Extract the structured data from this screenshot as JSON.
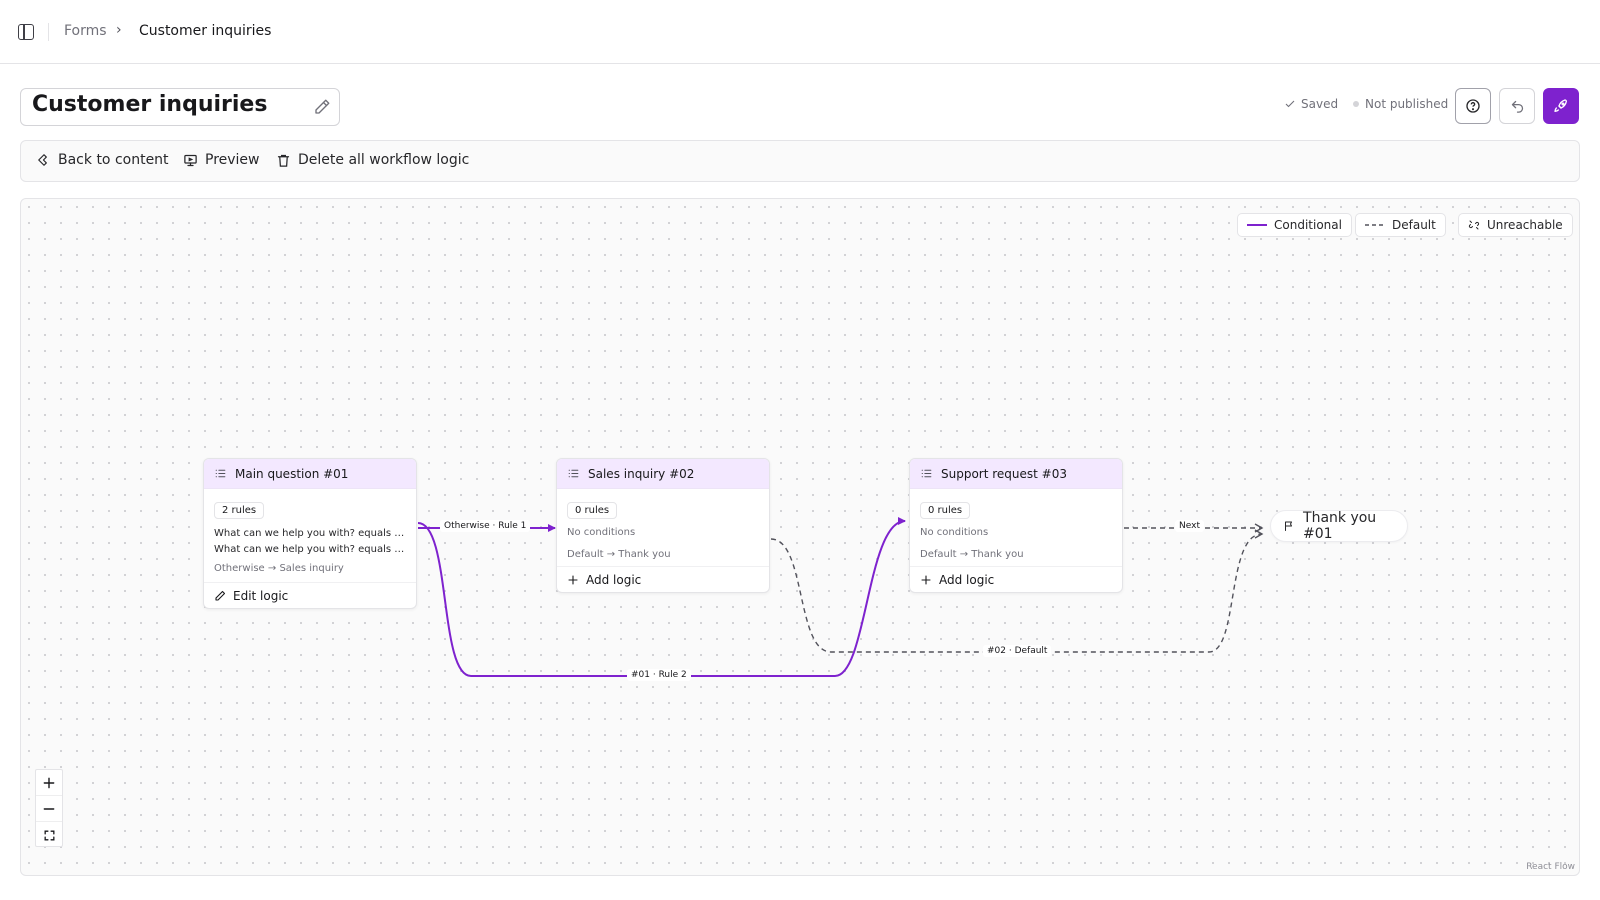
{
  "breadcrumb": {
    "root": "Forms",
    "separator": "›",
    "current": "Customer inquiries"
  },
  "form": {
    "title": "Customer inquiries"
  },
  "status": {
    "saved": "Saved",
    "published": "Not published"
  },
  "toolbar": {
    "back": "Back to content",
    "preview": "Preview",
    "delete": "Delete all workflow logic"
  },
  "legend": {
    "conditional": "Conditional",
    "default": "Default",
    "unreachable": "Unreachable"
  },
  "nodes": [
    {
      "title": "Main question #01",
      "badge": "2 rules",
      "rules": [
        "What can we help you with? equals Sales inquiry",
        "What can we help you with? equals Support request"
      ],
      "otherwise": "Otherwise → Sales inquiry",
      "action": "Edit logic"
    },
    {
      "title": "Sales inquiry #02",
      "badge": "0 rules",
      "conditions": "No conditions",
      "default": "Default → Thank you",
      "action": "Add logic"
    },
    {
      "title": "Support request #03",
      "badge": "0 rules",
      "conditions": "No conditions",
      "default": "Default → Thank you",
      "action": "Add logic"
    }
  ],
  "end_node": {
    "title": "Thank you #01"
  },
  "edges": {
    "otherwise_rule1": "Otherwise · Rule 1",
    "rule2": "#01 · Rule 2",
    "next": "Next",
    "default02": "#02 · Default"
  },
  "attribution": "React Flow",
  "colors": {
    "accent": "#7e22ce",
    "node_header": "#f3e8ff",
    "default_edge": "#52525b"
  },
  "icons": {
    "sidebar": "sidebar-toggle-icon",
    "edit": "pencil-icon",
    "help": "help-circle-icon",
    "undo": "undo-icon",
    "publish": "rocket-icon",
    "back": "back-icon",
    "preview": "monitor-icon",
    "delete": "trash-icon",
    "node": "list-icon",
    "end": "flag-icon"
  }
}
